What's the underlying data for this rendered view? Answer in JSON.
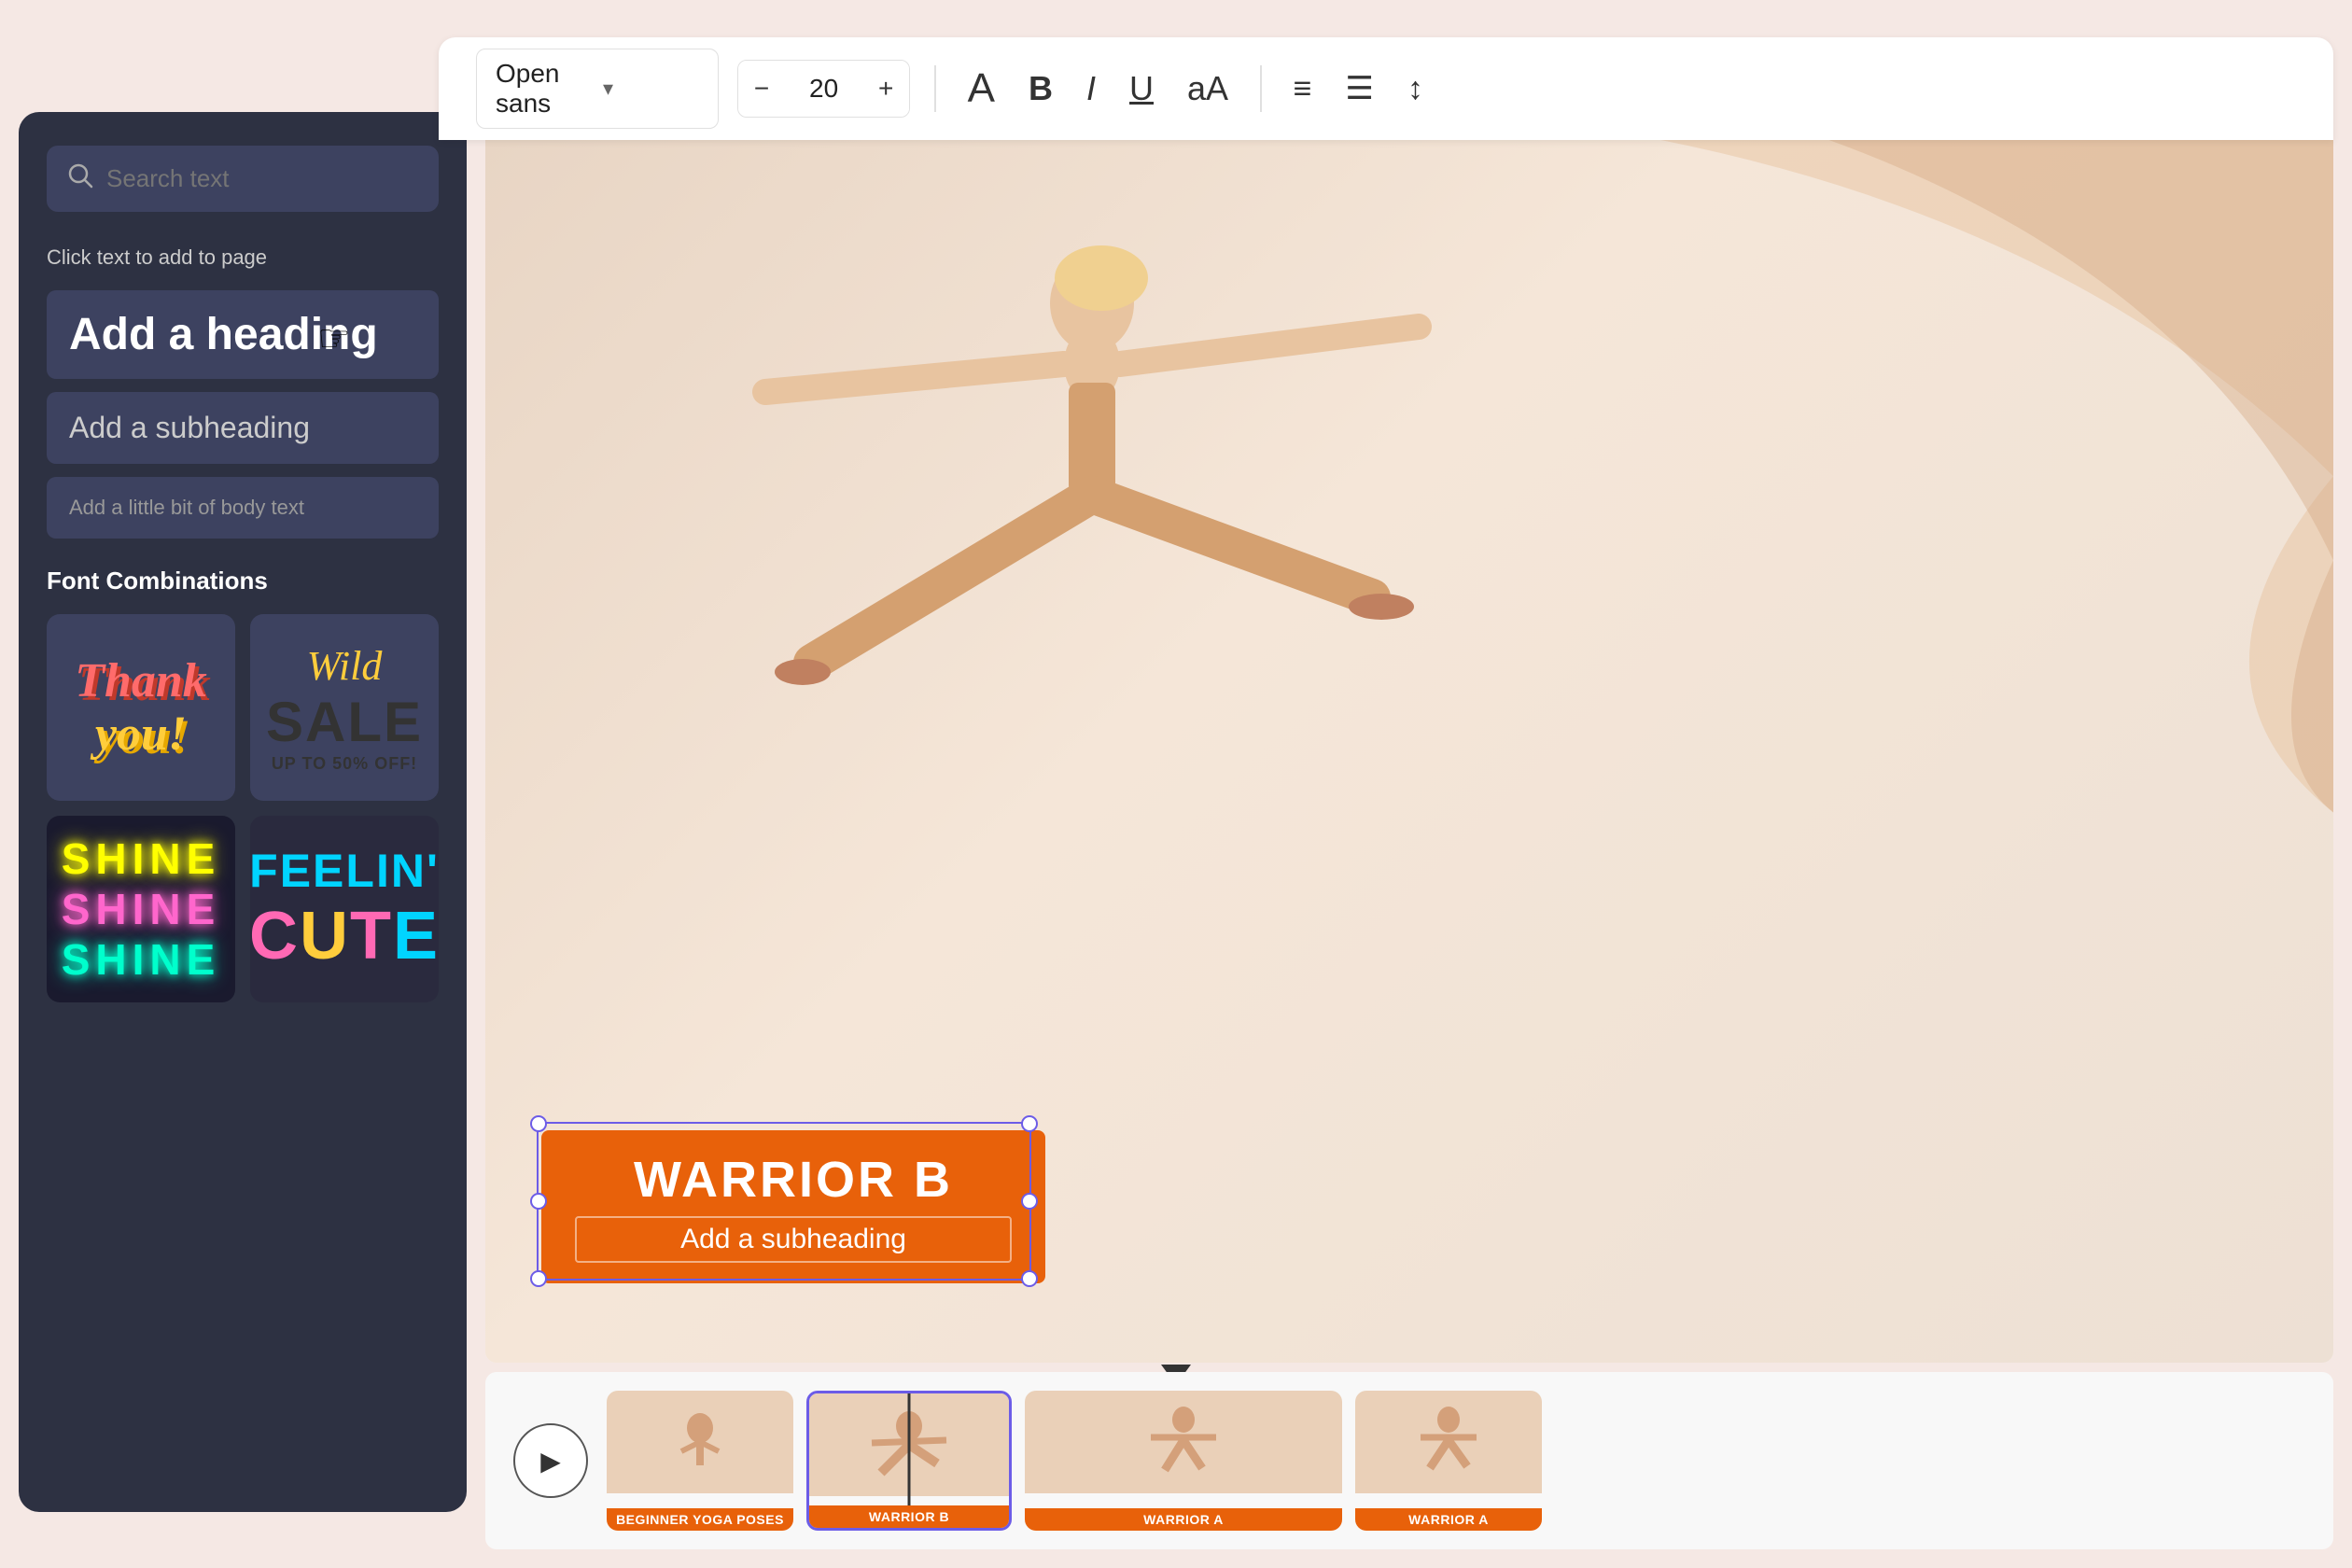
{
  "toolbar": {
    "font_name": "Open sans",
    "font_size": "20",
    "font_size_decrease": "−",
    "font_size_increase": "+",
    "icon_A": "A",
    "icon_B": "B",
    "icon_I": "I",
    "icon_U": "U",
    "icon_aA": "aA",
    "icon_align": "≡",
    "icon_list": "☰",
    "icon_spacing": "↕"
  },
  "left_panel": {
    "search_placeholder": "Search text",
    "click_label": "Click text to add to page",
    "heading_text": "Add a heading",
    "subheading_text": "Add a subheading",
    "body_text": "Add a little bit of body text",
    "font_combinations_label": "Font Combinations",
    "combo1_line1": "Thank",
    "combo1_line2": "you!",
    "combo2_line1": "Wild",
    "combo2_line2": "SALE",
    "combo2_line3": "UP TO 50% OFF!",
    "combo3_line1": "SHINE",
    "combo3_line2": "SHINE",
    "combo3_line3": "SHINE",
    "combo4_line1": "FEELIN'",
    "combo4_line2": "CUTE"
  },
  "canvas": {
    "warrior_title": "WARRIOR B",
    "warrior_sub": "Add a subheading"
  },
  "timeline": {
    "play_icon": "▶",
    "thumb1_label": "BEGINNER YOGA POSES",
    "thumb2_label": "WARRIOR B",
    "thumb3_label": "WARRIOR A",
    "thumb4_label": "WARRIOR A"
  }
}
